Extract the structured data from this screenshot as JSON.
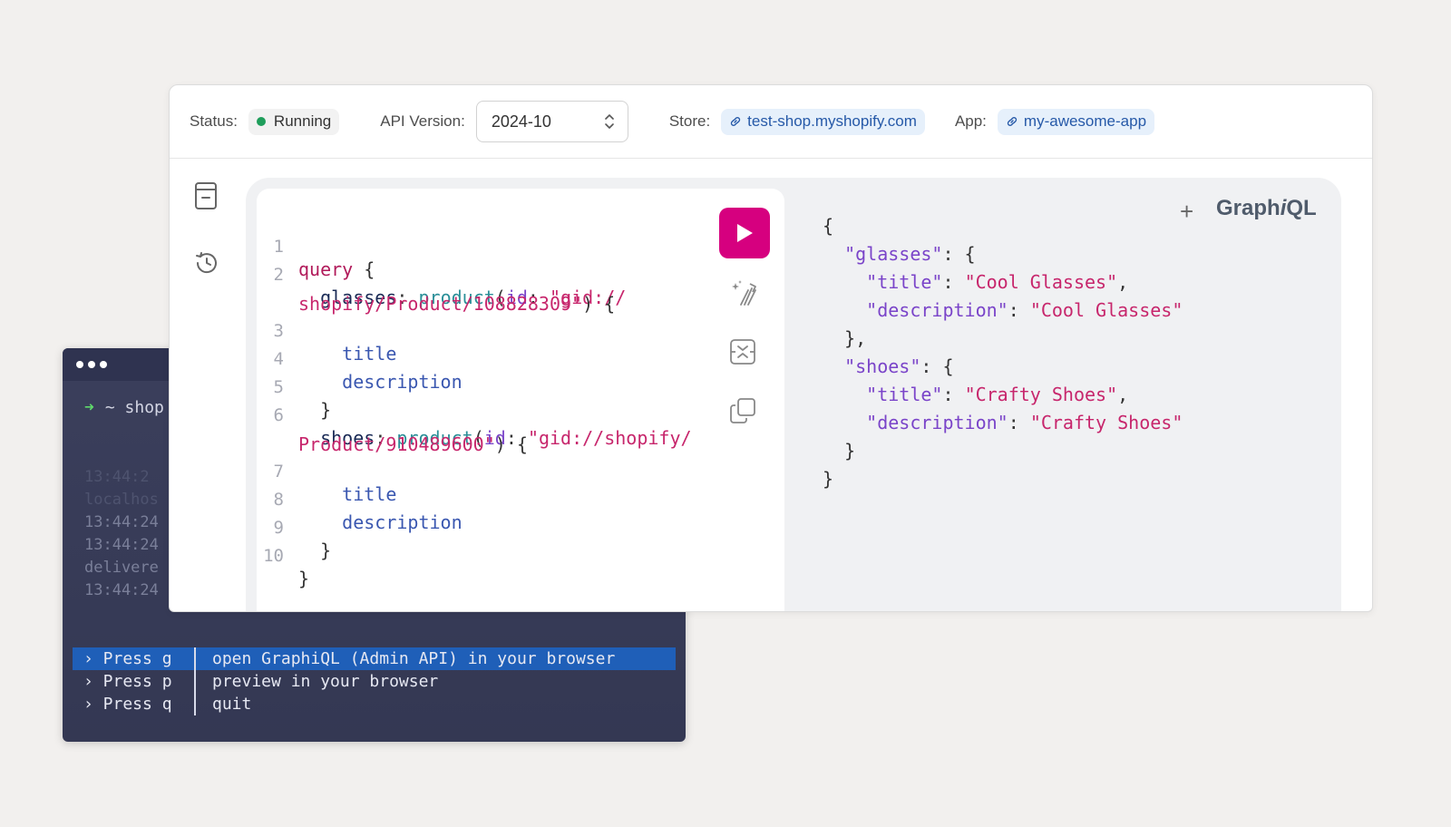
{
  "terminal": {
    "prompt_symbol": "➜",
    "prompt_text": "~ shop",
    "log_lines": [
      "13:44:2",
      "localhos",
      "13:44:24",
      "13:44:24",
      "delivere",
      "13:44:24"
    ],
    "menu": [
      {
        "key": "› Press g",
        "desc": "open GraphiQL (Admin API) in your browser",
        "active": true
      },
      {
        "key": "› Press p",
        "desc": "preview in your browser",
        "active": false
      },
      {
        "key": "› Press q",
        "desc": "quit",
        "active": false
      }
    ]
  },
  "topbar": {
    "status_label": "Status:",
    "status_value": "Running",
    "api_version_label": "API Version:",
    "api_version_value": "2024-10",
    "store_label": "Store:",
    "store_value": "test-shop.myshopify.com",
    "app_label": "App:",
    "app_value": "my-awesome-app"
  },
  "logo": {
    "prefix": "Graph",
    "italic": "i",
    "suffix": "QL"
  },
  "plus_label": "+",
  "query": {
    "line_numbers": [
      "1",
      "2",
      "",
      "3",
      "4",
      "5",
      "6",
      "",
      "7",
      "8",
      "9",
      "10"
    ],
    "l1_kw": "query",
    "l1_rest": " {",
    "l2_field": "glasses",
    "l2_colon": ": ",
    "l2_fn": "product",
    "l2_open": "(",
    "l2_arg": "id",
    "l2_argcolon": ": ",
    "l2_str": "\"gid://",
    "l2b_str": "shopify/Product/108828309\"",
    "l2b_rest": ") {",
    "l3": "title",
    "l4": "description",
    "l5": "}",
    "l6_field": "shoes",
    "l6_colon": ": ",
    "l6_fn": "product",
    "l6_open": "(",
    "l6_arg": "id",
    "l6_argcolon": ": ",
    "l6_str": "\"gid://shopify/",
    "l6b_str": "Product/910489600\"",
    "l6b_rest": ") {",
    "l7": "title",
    "l8": "description",
    "l9": "}",
    "l10": "}"
  },
  "result": {
    "r1": "{",
    "r2_key": "\"glasses\"",
    "r2_rest": ": {",
    "r3_key": "\"title\"",
    "r3_mid": ": ",
    "r3_val": "\"Cool Glasses\"",
    "r3_end": ",",
    "r4_key": "\"description\"",
    "r4_mid": ": ",
    "r4_val": "\"Cool Glasses\"",
    "r5": "},",
    "r6_key": "\"shoes\"",
    "r6_rest": ": {",
    "r7_key": "\"title\"",
    "r7_mid": ": ",
    "r7_val": "\"Crafty Shoes\"",
    "r7_end": ",",
    "r8_key": "\"description\"",
    "r8_mid": ": ",
    "r8_val": "\"Crafty Shoes\"",
    "r9": "}",
    "r10": "}"
  },
  "colors": {
    "accent": "#d6007f",
    "link_bg": "#e6f0fb",
    "status_dot": "#1f9e5b",
    "terminal_highlight": "#1f5fb8"
  },
  "icons": [
    "doc-icon",
    "history-icon",
    "run-icon",
    "prettify-icon",
    "merge-icon",
    "copy-icon",
    "link-icon",
    "updown-icon"
  ]
}
